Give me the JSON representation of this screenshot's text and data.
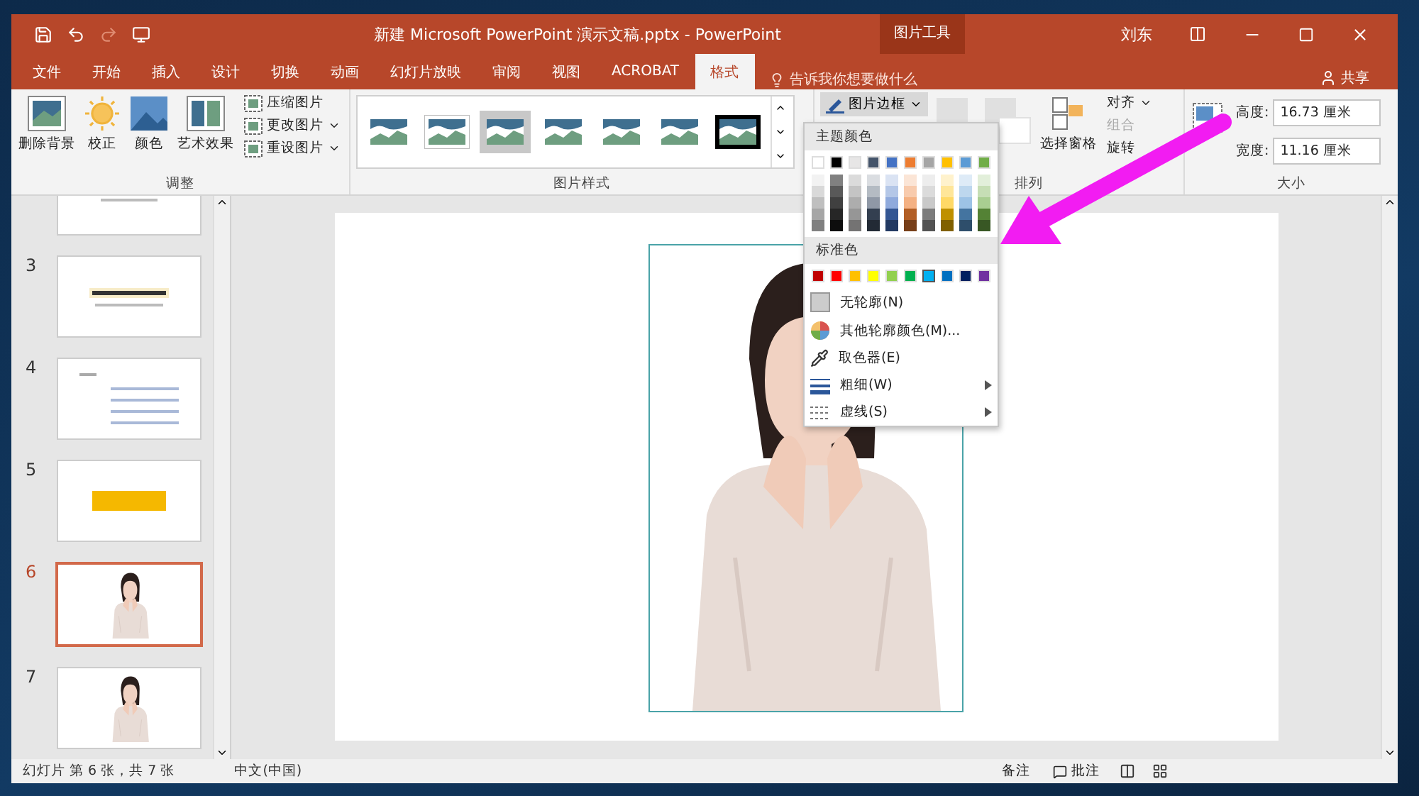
{
  "title": "新建 Microsoft PowerPoint 演示文稿.pptx  -  PowerPoint",
  "context_tab": "图片工具",
  "user": "刘东",
  "tabs": [
    {
      "label": "文件",
      "selected": false
    },
    {
      "label": "开始",
      "selected": false
    },
    {
      "label": "插入",
      "selected": false
    },
    {
      "label": "设计",
      "selected": false
    },
    {
      "label": "切换",
      "selected": false
    },
    {
      "label": "动画",
      "selected": false
    },
    {
      "label": "幻灯片放映",
      "selected": false
    },
    {
      "label": "审阅",
      "selected": false
    },
    {
      "label": "视图",
      "selected": false
    },
    {
      "label": "ACROBAT",
      "selected": false
    },
    {
      "label": "格式",
      "selected": true
    }
  ],
  "tell_me": "告诉我你想要做什么",
  "share": "共享",
  "adjust_group": {
    "label": "调整",
    "large_buttons": [
      {
        "label": "删除背景",
        "kind": "remove-bg"
      },
      {
        "label": "校正",
        "kind": "sun"
      },
      {
        "label": "颜色",
        "kind": "color"
      },
      {
        "label": "艺术效果",
        "kind": "art"
      }
    ],
    "small_buttons": [
      {
        "label": "压缩图片",
        "dropdown": false
      },
      {
        "label": "更改图片",
        "dropdown": true
      },
      {
        "label": "重设图片",
        "dropdown": true
      }
    ]
  },
  "styles_group": {
    "label": "图片样式",
    "styles": [
      {
        "kind": "plain",
        "selected": false
      },
      {
        "kind": "frame",
        "selected": false
      },
      {
        "kind": "plain",
        "selected": true
      },
      {
        "kind": "soft",
        "selected": false
      },
      {
        "kind": "soft",
        "selected": false
      },
      {
        "kind": "plain",
        "selected": false
      },
      {
        "kind": "black-frame",
        "selected": false
      }
    ]
  },
  "border_button": "图片边框",
  "arrange_group": {
    "label": "排列",
    "select_pane": "选择窗格",
    "align": "对齐",
    "group": {
      "label": "组合",
      "disabled": true
    },
    "rotate": "旋转"
  },
  "size_group": {
    "label": "大小",
    "height_label": "高度:",
    "height": "16.73 厘米",
    "width_label": "宽度:",
    "width": "11.16 厘米"
  },
  "menu": {
    "theme_heading": "主题颜色",
    "theme_colors": [
      {
        "color": "#ffffff"
      },
      {
        "color": "#000000"
      },
      {
        "color": "#e7e6e6"
      },
      {
        "color": "#44546a"
      },
      {
        "color": "#4472c4"
      },
      {
        "color": "#ed7d31"
      },
      {
        "color": "#a5a5a5"
      },
      {
        "color": "#ffc000"
      },
      {
        "color": "#5b9bd5"
      },
      {
        "color": "#70ad47"
      }
    ],
    "standard_heading": "标准色",
    "standard_colors": [
      {
        "color": "#c00000",
        "selected": false
      },
      {
        "color": "#ff0000",
        "selected": false
      },
      {
        "color": "#ffc000",
        "selected": false
      },
      {
        "color": "#ffff00",
        "selected": false
      },
      {
        "color": "#92d050",
        "selected": false
      },
      {
        "color": "#00b050",
        "selected": false
      },
      {
        "color": "#00b0f0",
        "selected": true
      },
      {
        "color": "#0070c0",
        "selected": false
      },
      {
        "color": "#002060",
        "selected": false
      },
      {
        "color": "#7030a0",
        "selected": false
      }
    ],
    "items": [
      {
        "label": "无轮廓(N)",
        "kind": "none",
        "submenu": false
      },
      {
        "label": "其他轮廓颜色(M)...",
        "kind": "more",
        "submenu": false
      },
      {
        "label": "取色器(E)",
        "kind": "eyedropper",
        "submenu": false
      },
      {
        "label": "粗细(W)",
        "kind": "weight",
        "submenu": true
      },
      {
        "label": "虚线(S)",
        "kind": "dash",
        "submenu": true
      }
    ]
  },
  "slides": [
    {
      "kind": "text",
      "selected": false
    },
    {
      "number": "3",
      "kind": "title",
      "selected": false
    },
    {
      "number": "4",
      "kind": "list",
      "selected": false
    },
    {
      "number": "5",
      "kind": "banner",
      "selected": false
    },
    {
      "number": "6",
      "selected": true
    },
    {
      "number": "7",
      "selected": false
    }
  ],
  "status_bar": {
    "slide_info": "幻灯片 第 6 张，共 7 张",
    "language": "中文(中国)",
    "notes": "备注",
    "comments": "批注"
  }
}
